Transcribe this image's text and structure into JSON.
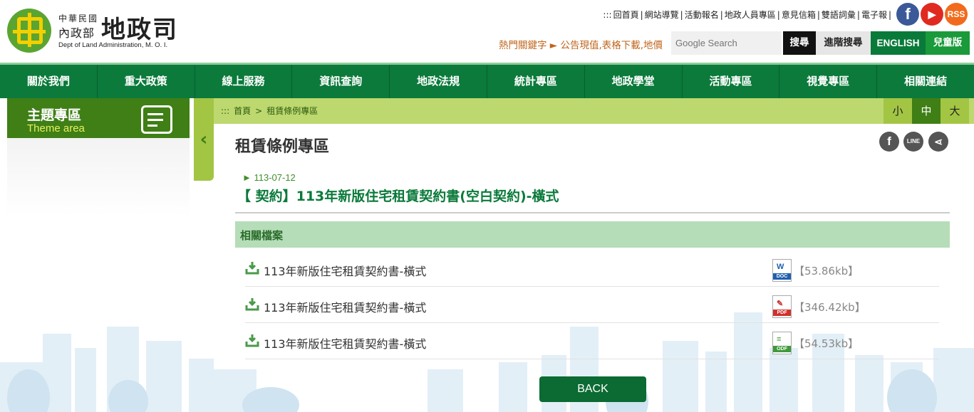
{
  "header": {
    "logo_line1": "中華民國",
    "logo_line2": "內政部",
    "logo_big": "地政司",
    "logo_en": "Dept of Land Administration, M. O. I.",
    "top_links": [
      ":::",
      "回首頁",
      "|",
      "網站導覽",
      "|",
      "活動報名",
      "|",
      "地政人員專區",
      "|",
      "意見信箱",
      "|",
      "雙語詞彙",
      "|",
      "電子報",
      "|"
    ],
    "social": {
      "facebook": "f",
      "youtube": "▶",
      "rss": "RSS"
    },
    "hot_keywords": "熱門關鍵字 ► 公告現值,表格下載,地價",
    "search_placeholder": "Google Search",
    "search_button": "搜尋",
    "advanced_search": "進階搜尋",
    "english": "ENGLISH",
    "kids": "兒童版"
  },
  "nav": [
    "關於我們",
    "重大政策",
    "線上服務",
    "資訊查詢",
    "地政法規",
    "統計專區",
    "地政學堂",
    "活動專區",
    "視覺專區",
    "相關連結"
  ],
  "sidebar": {
    "title_zh": "主題專區",
    "title_en": "Theme area",
    "toggle": "‹"
  },
  "breadcrumb": [
    ":::",
    "首頁",
    ">",
    "租賃條例專區"
  ],
  "font_size": {
    "small": "小",
    "medium": "中",
    "large": "大"
  },
  "page_title": "租賃條例專區",
  "share": {
    "facebook": "f",
    "line": "LINE",
    "share": "⋖"
  },
  "article": {
    "date": "► 113-07-12",
    "title": "【 契約】113年新版住宅租賃契約書(空白契約)-橫式"
  },
  "files": {
    "header": "相關檔案",
    "items": [
      {
        "name": "113年新版住宅租賃契約書-橫式",
        "type": "DOC",
        "size": "【53.86kb】"
      },
      {
        "name": "113年新版住宅租賃契約書-橫式",
        "type": "PDF",
        "size": "【346.42kb】"
      },
      {
        "name": "113年新版住宅租賃契約書-橫式",
        "type": "ODF",
        "size": "【54.53kb】"
      }
    ]
  },
  "back": "BACK",
  "colors": {
    "nav_green": "#0b7a3b",
    "crumb_green": "#bcd86e",
    "theme_green": "#3f7f16",
    "files_header": "#b5ddb8",
    "doc_blue": "#1f5fb0",
    "pdf_red": "#d0312d",
    "odf_green": "#3f9a3a"
  }
}
